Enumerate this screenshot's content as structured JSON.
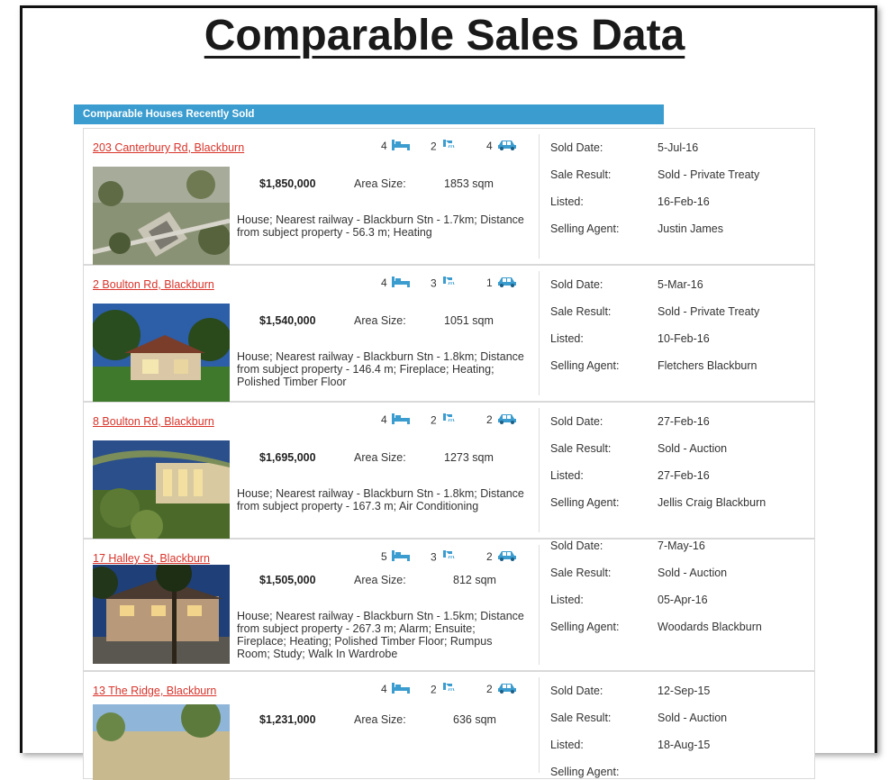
{
  "title": "Comparable Sales Data",
  "section_title": "Comparable Houses Recently Sold",
  "colors": {
    "accent_bar": "#3a9ccf",
    "link": "#d9342b",
    "icon": "#3a9ccf"
  },
  "detail_labels": {
    "sold_date": "Sold Date:",
    "sale_result": "Sale Result:",
    "listed": "Listed:",
    "selling_agent": "Selling Agent:"
  },
  "area_label": "Area Size:",
  "listings": [
    {
      "address": "203 Canterbury Rd, Blackburn",
      "beds": "4",
      "baths": "2",
      "cars": "4",
      "price": "$1,850,000",
      "area": "1853 sqm",
      "description": "House; Nearest railway - Blackburn Stn - 1.7km; Distance from subject property - 56.3 m; Heating",
      "sold_date": "5-Jul-16",
      "sale_result": "Sold - Private Treaty",
      "listed": "16-Feb-16",
      "agent": "Justin James"
    },
    {
      "address": "2 Boulton Rd, Blackburn",
      "beds": "4",
      "baths": "3",
      "cars": "1",
      "price": "$1,540,000",
      "area": "1051 sqm",
      "description": "House; Nearest railway - Blackburn Stn - 1.8km; Distance from subject property - 146.4 m; Fireplace; Heating; Polished Timber Floor",
      "sold_date": "5-Mar-16",
      "sale_result": "Sold - Private Treaty",
      "listed": "10-Feb-16",
      "agent": "Fletchers Blackburn"
    },
    {
      "address": "8 Boulton Rd, Blackburn",
      "beds": "4",
      "baths": "2",
      "cars": "2",
      "price": "$1,695,000",
      "area": "1273 sqm",
      "description": "House; Nearest railway - Blackburn Stn - 1.8km; Distance from subject property - 167.3 m; Air Conditioning",
      "sold_date": "27-Feb-16",
      "sale_result": "Sold - Auction",
      "listed": "27-Feb-16",
      "agent": "Jellis Craig Blackburn"
    },
    {
      "address": "17 Halley St, Blackburn",
      "beds": "5",
      "baths": "3",
      "cars": "2",
      "price": "$1,505,000",
      "area": "812 sqm",
      "description": "House; Nearest railway - Blackburn Stn - 1.5km; Distance from subject property - 267.3 m; Alarm; Ensuite; Fireplace; Heating; Polished Timber Floor; Rumpus Room; Study; Walk In Wardrobe",
      "sold_date": "7-May-16",
      "sale_result": "Sold - Auction",
      "listed": "05-Apr-16",
      "agent": "Woodards Blackburn"
    },
    {
      "address": "13 The Ridge, Blackburn",
      "beds": "4",
      "baths": "2",
      "cars": "2",
      "price": "$1,231,000",
      "area": "636 sqm",
      "description": "",
      "sold_date": "12-Sep-15",
      "sale_result": "Sold - Auction",
      "listed": "18-Aug-15",
      "agent": ""
    }
  ]
}
